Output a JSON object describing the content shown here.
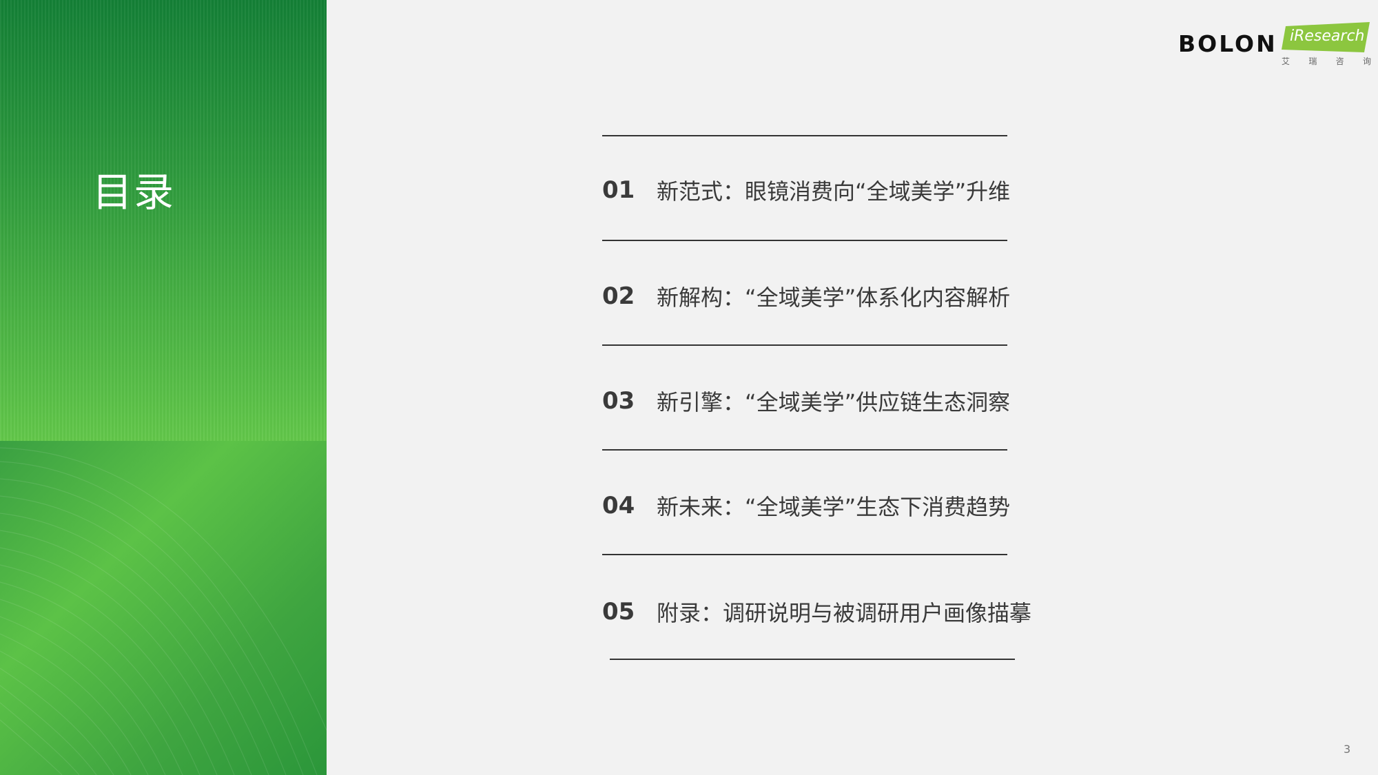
{
  "sidebar": {
    "title": "目录"
  },
  "logo": {
    "brand": "BOLON",
    "partner": "iResearch",
    "partner_cn": [
      "艾",
      "瑞",
      "咨",
      "询"
    ],
    "partner_color": "#8cc63f"
  },
  "toc": {
    "items": [
      {
        "num": "01",
        "text": "新范式：眼镜消费向“全域美学”升维"
      },
      {
        "num": "02",
        "text": "新解构：“全域美学”体系化内容解析"
      },
      {
        "num": "03",
        "text": "新引擎：“全域美学”供应链生态洞察"
      },
      {
        "num": "04",
        "text": "新未来：“全域美学”生态下消费趋势"
      },
      {
        "num": "05",
        "text": "附录：调研说明与被调研用户画像描摹"
      }
    ]
  },
  "page_number": "3",
  "colors": {
    "sidebar_green": "#2e9a3d",
    "accent_green": "#5cc246",
    "text": "#3a3a3a"
  }
}
